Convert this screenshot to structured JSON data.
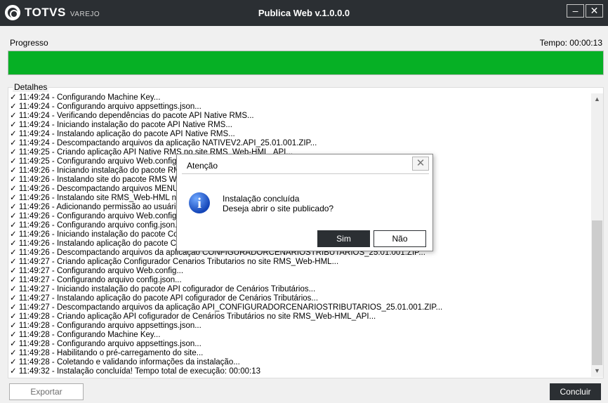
{
  "window": {
    "brand": "TOTVS",
    "brand_sub": "VAREJO",
    "title": "Publica Web v.1.0.0.0",
    "min_icon": "minimize-icon",
    "close_icon": "close-icon"
  },
  "progress": {
    "label": "Progresso",
    "time": "Tempo:  00:00:13",
    "value_percent": 100,
    "color": "#06b025"
  },
  "details": {
    "legend": "Detalhes",
    "lines": [
      "✓ 11:49:24 - Configurando Machine Key...",
      "✓ 11:49:24 - Configurando arquivo appsettings.json...",
      "✓ 11:49:24 - Verificando dependências do pacote API Native RMS...",
      "✓ 11:49:24 - Iniciando instalação do pacote API Native RMS...",
      "✓ 11:49:24 - Instalando aplicação do pacote API Native RMS...",
      "✓ 11:49:24 - Descompactando arquivos da aplicação NATIVEV2.API_25.01.001.ZIP...",
      "✓ 11:49:25 - Criando aplicação API Native RMS no site RMS_Web-HML_API...",
      "✓ 11:49:25 - Configurando arquivo Web.config...",
      "✓ 11:49:26 - Iniciando instalação do pacote RMS",
      "✓ 11:49:26 - Instalando site do pacote RMS Web",
      "✓ 11:49:26 - Descompactando arquivos MENU.W",
      "✓ 11:49:26 - Instalando site RMS_Web-HML no II",
      "✓ 11:49:26 - Adicionando permissão ao usuário IIS",
      "✓ 11:49:26 - Configurando arquivo Web.config...",
      "✓ 11:49:26 - Configurando arquivo config.json...",
      "✓ 11:49:26 - Iniciando instalação do pacote Conf",
      "✓ 11:49:26 - Instalando aplicação do pacote Conf",
      "✓ 11:49:26 - Descompactando arquivos da aplicação CONFIGURADORCENARIOSTRIBUTARIOS_25.01.001.ZIP...",
      "✓ 11:49:27 - Criando aplicação Configurador Cenarios Tributarios no site RMS_Web-HML...",
      "✓ 11:49:27 - Configurando arquivo Web.config...",
      "✓ 11:49:27 - Configurando arquivo config.json...",
      "✓ 11:49:27 - Iniciando instalação do pacote API cofigurador de Cenários Tributários...",
      "✓ 11:49:27 - Instalando aplicação do pacote API cofigurador de Cenários Tributários...",
      "✓ 11:49:27 - Descompactando arquivos da aplicação API_CONFIGURADORCENARIOSTRIBUTARIOS_25.01.001.ZIP...",
      "✓ 11:49:28 - Criando aplicação API cofigurador de Cenários Tributários no site RMS_Web-HML_API...",
      "✓ 11:49:28 - Configurando arquivo appsettings.json...",
      "✓ 11:49:28 - Configurando Machine Key...",
      "✓ 11:49:28 - Configurando arquivo appsettings.json...",
      "✓ 11:49:28 - Habilitando o pré-carregamento do site...",
      "✓ 11:49:28 - Coletando e validando informações da instalação...",
      "✓ 11:49:32 - Instalação concluída! Tempo total de execução: 00:00:13"
    ]
  },
  "buttons": {
    "export": "Exportar",
    "finish": "Concluir"
  },
  "dialog": {
    "title": "Atenção",
    "icon": "info-icon",
    "message_line1": "Instalação concluída",
    "message_line2": "Deseja abrir o site publicado?",
    "yes": "Sim",
    "no": "Não"
  }
}
